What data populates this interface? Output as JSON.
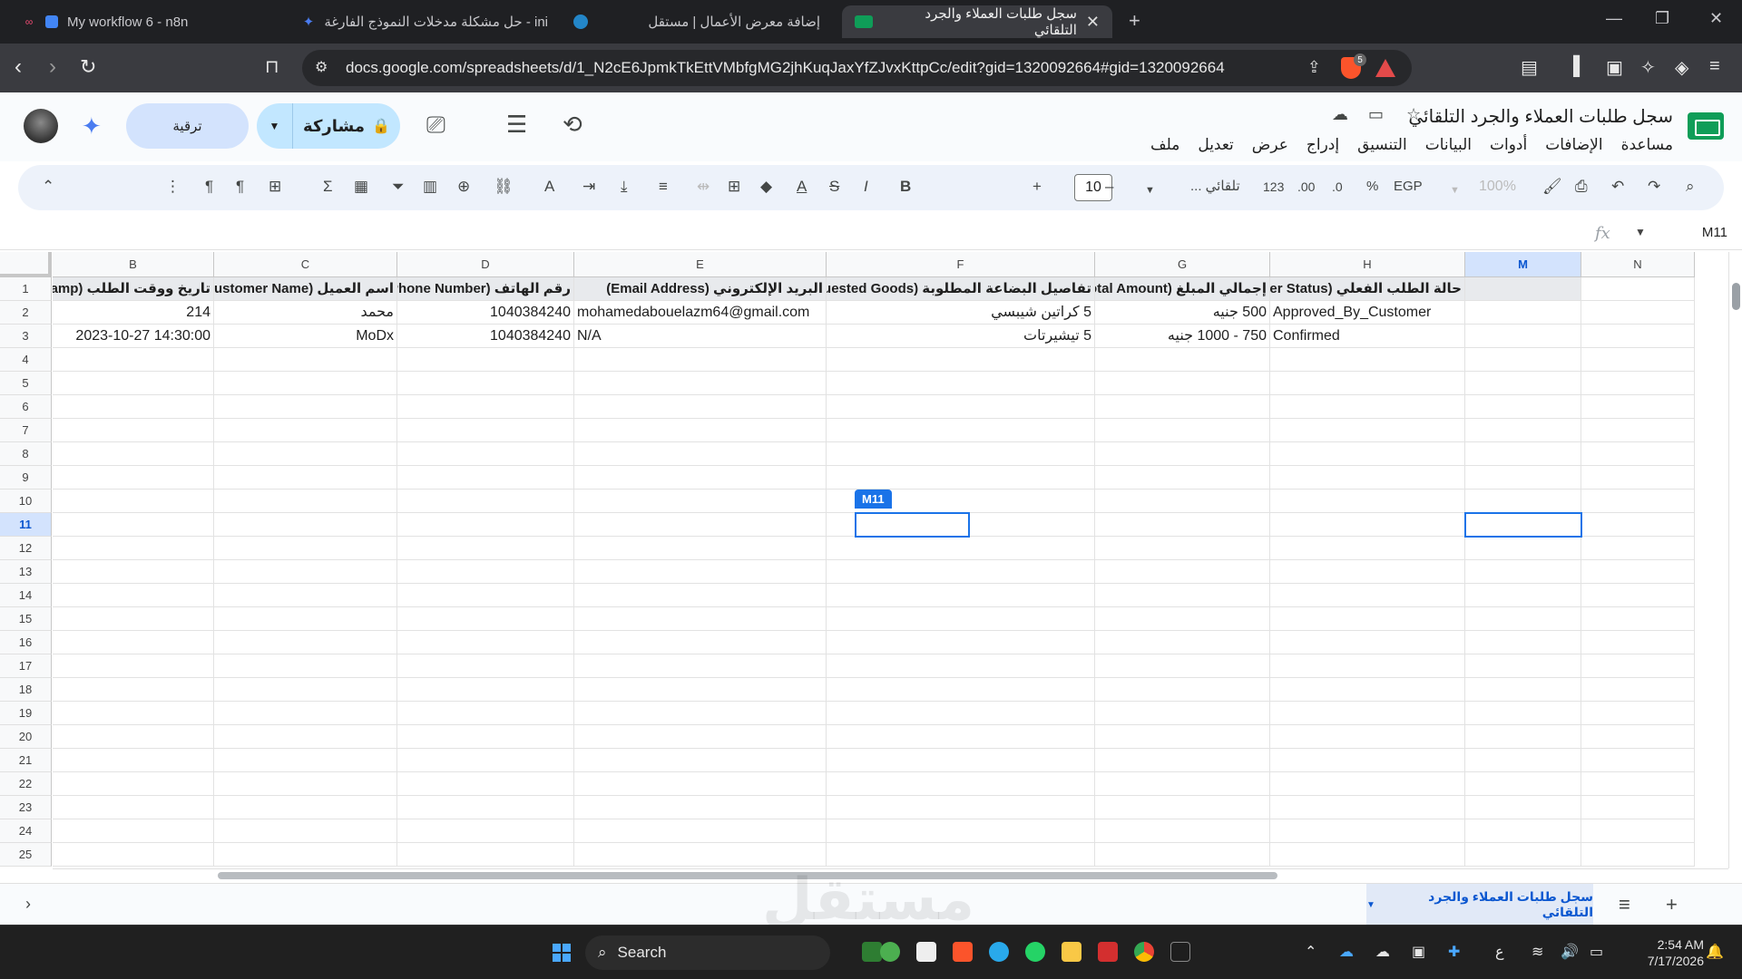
{
  "browser": {
    "tabs": [
      {
        "title": "My workflow 6 - n8n",
        "active": false
      },
      {
        "title": "ini - حل مشكلة مدخلات النموذج الفارغة",
        "active": false
      },
      {
        "title": "إضافة معرض الأعمال | مستقل",
        "active": false
      },
      {
        "title": "سجل طلبات العملاء والجرد التلقائي",
        "active": true
      }
    ],
    "url": "docs.google.com/spreadsheets/d/1_N2cE6JpmkTkEttVMbfgMG2jhKuqJaxYfZJvxKttpCc/edit?gid=1320092664#gid=1320092664",
    "shield_badge": "5"
  },
  "sheets": {
    "doc_title": "سجل طلبات العملاء والجرد التلقائي",
    "menu": [
      "ملف",
      "تعديل",
      "عرض",
      "إدراج",
      "التنسيق",
      "البيانات",
      "أدوات",
      "الإضافات",
      "مساعدة"
    ],
    "upgrade_label": "ترقية",
    "share_label": "مشاركة",
    "toolbar": {
      "zoom": "100%",
      "currency": "EGP",
      "percent": "%",
      "dec_decrease": ".0",
      "dec_increase": ".00",
      "number_format": "123",
      "font": "تلقائي ...",
      "font_size": "10"
    },
    "name_box": "M11",
    "fx_label": "fx"
  },
  "grid": {
    "columns": [
      "B",
      "C",
      "D",
      "E",
      "F",
      "G",
      "H",
      "M",
      "N"
    ],
    "selected_column": "M",
    "rows": [
      "1",
      "2",
      "3",
      "4",
      "5",
      "6",
      "7",
      "8",
      "9",
      "10",
      "11",
      "12",
      "13",
      "14",
      "15",
      "16",
      "17",
      "18",
      "19",
      "20",
      "21",
      "22",
      "23",
      "24",
      "25"
    ],
    "selected_row": "11",
    "header_row": [
      "تاريخ ووقت الطلب (Timestamp",
      "اسم العميل (Customer Name)",
      "رقم الهاتف (Phone Number)",
      "البريد الإلكتروني (Email Address)",
      "تفاصيل البضاعة المطلوبة (Requested Goods)",
      "إجمالي المبلغ (Total Amount)",
      "حالة الطلب الفعلي (Order Status)",
      ""
    ],
    "data_rows": [
      [
        "214",
        "محمد",
        "1040384240",
        "mohamedabouelazm64@gmail.com",
        "5 كراتين شيبسي",
        "500 جنيه",
        "Approved_By_Customer",
        ""
      ],
      [
        "2023-10-27 14:30:00",
        "MoDx",
        "1040384240",
        "N/A",
        "5 تيشيرتات",
        "750 - 1000 جنيه",
        "Confirmed",
        ""
      ]
    ],
    "collaborator_tag": "M11"
  },
  "sheet_tabs": {
    "active": "سجل طلبات العملاء والجرد التلقائي"
  },
  "taskbar": {
    "search_placeholder": "Search",
    "lang": "ع",
    "time": "2:54 AM",
    "date": "7/17/2026"
  },
  "watermark": "مستقل"
}
